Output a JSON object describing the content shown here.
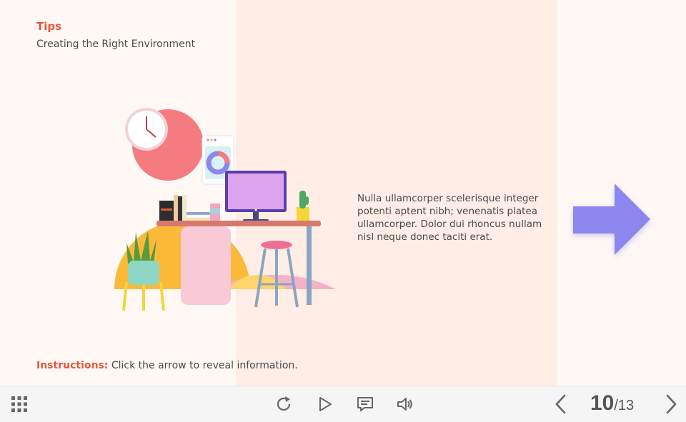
{
  "slide": {
    "tips_title": "Tips",
    "tips_subtitle": "Creating the Right Environment",
    "info_text": "Nulla ullamcorper scelerisque integer potenti aptent nibh; venenatis platea ullamcorper. Dolor dui rhoncus nullam nisl neque donec taciti erat.",
    "instructions_label": "Instructions:",
    "instructions_text": " Click the arrow to reveal information."
  },
  "colors": {
    "accent": "#e4573c",
    "arrow": "#8b87ee",
    "panel": "#ffede6"
  },
  "toolbar": {
    "menu_icon": "grid-menu-icon",
    "replay_icon": "replay-icon",
    "play_icon": "play-icon",
    "captions_icon": "captions-icon",
    "volume_icon": "volume-icon",
    "prev_icon": "chevron-left-icon",
    "next_icon": "chevron-right-icon",
    "current_page": "10",
    "total_pages": "/13"
  }
}
